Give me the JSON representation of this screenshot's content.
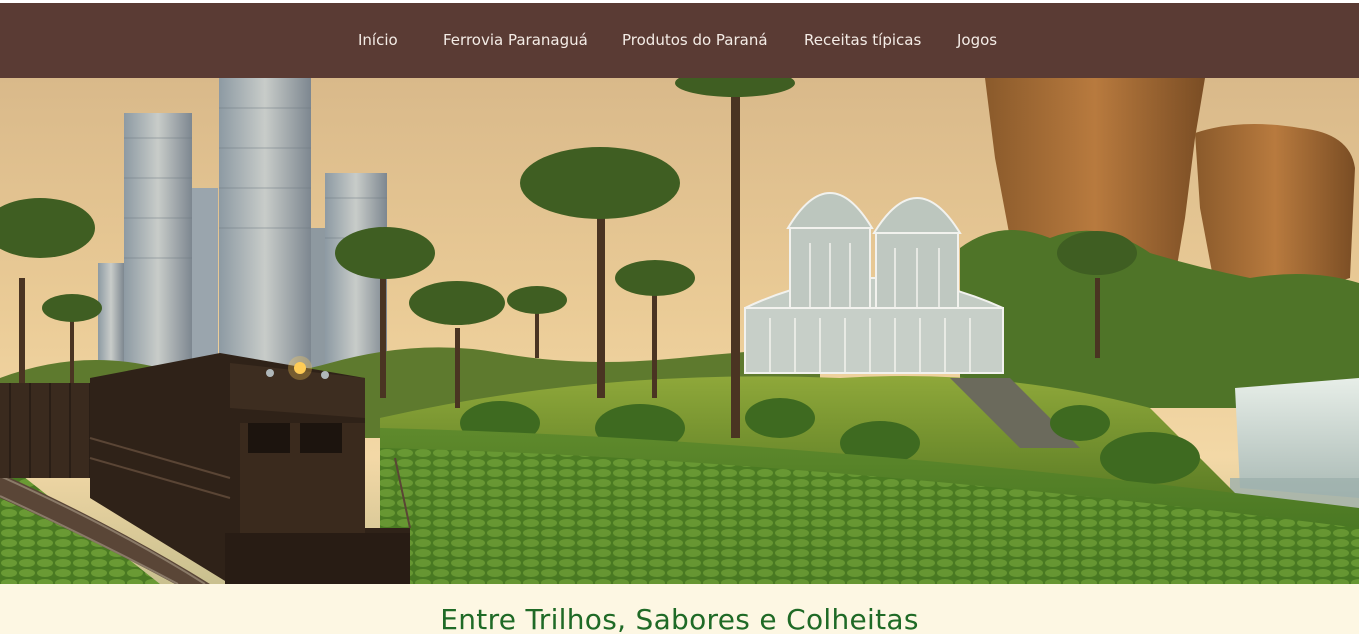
{
  "nav": {
    "items": [
      {
        "label": "Início"
      },
      {
        "label": "Ferrovia Paranaguá"
      },
      {
        "label": "Produtos do Paraná"
      },
      {
        "label": "Receitas típicas"
      },
      {
        "label": "Jogos"
      }
    ]
  },
  "hero": {
    "icon": "hero-landscape-image"
  },
  "main": {
    "title": "Entre Trilhos, Sabores e Colheitas"
  },
  "colors": {
    "nav_bg": "#5a3b34",
    "nav_text": "#f4ece6",
    "title_band_bg": "#fdf7e3",
    "title_text": "#1f6a26"
  }
}
